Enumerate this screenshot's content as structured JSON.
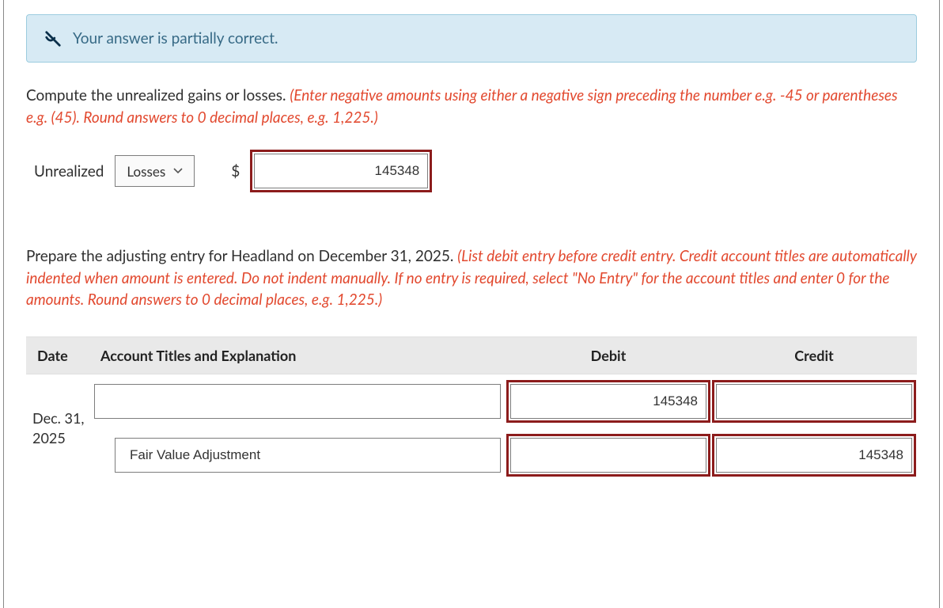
{
  "alert": {
    "text": "Your answer is partially correct."
  },
  "section1": {
    "prompt_black": "Compute the unrealized gains or losses. ",
    "prompt_red": "(Enter negative amounts using either a negative sign preceding the number e.g. -45 or parentheses e.g. (45). Round answers to 0 decimal places, e.g. 1,225.)"
  },
  "unrealized": {
    "label": "Unrealized",
    "select_value": "Losses",
    "currency": "$",
    "amount": "145348"
  },
  "section2": {
    "prompt_black": "Prepare the adjusting entry for Headland on December 31, 2025. ",
    "prompt_red": "(List debit entry before credit entry. Credit account titles are automatically indented when amount is entered. Do not indent manually. If no entry is required, select \"No Entry\" for the account titles and enter 0 for the amounts. Round answers to 0 decimal places, e.g. 1,225.)"
  },
  "table": {
    "headers": {
      "date": "Date",
      "acct": "Account Titles and Explanation",
      "debit": "Debit",
      "credit": "Credit"
    },
    "date": "Dec. 31, 2025",
    "row1": {
      "acct": "",
      "debit": "145348",
      "credit": ""
    },
    "row2": {
      "acct": "Fair Value Adjustment",
      "debit": "",
      "credit": "145348"
    }
  }
}
